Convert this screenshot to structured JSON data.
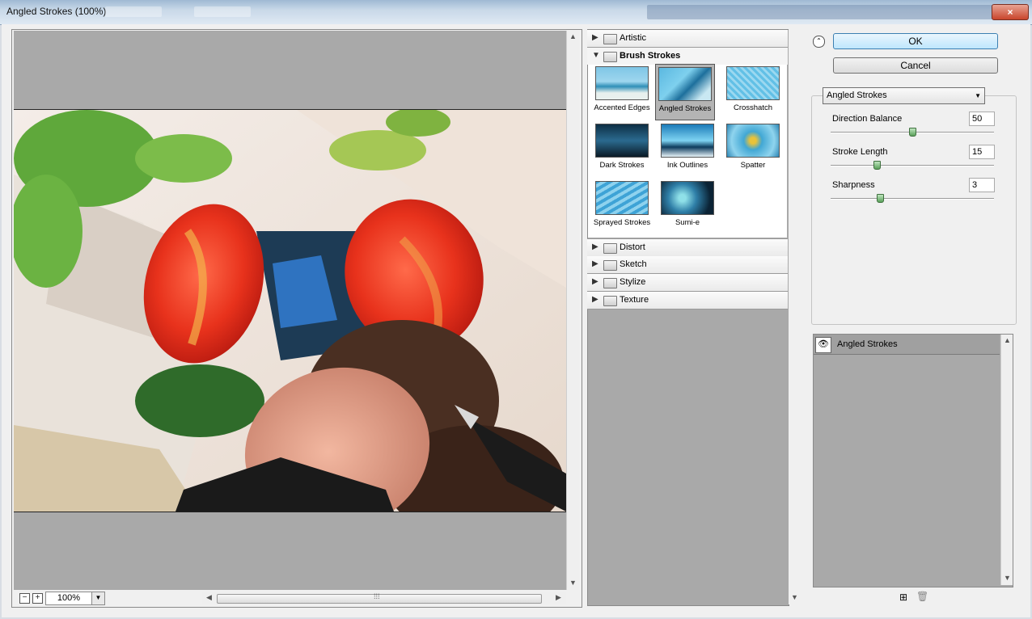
{
  "window": {
    "title": "Angled Strokes (100%)",
    "close_glyph": "×"
  },
  "preview": {
    "zoom": "100%",
    "zoom_out_glyph": "−",
    "zoom_in_glyph": "+",
    "hscroll_grip": "⁞⁞⁞"
  },
  "gallery": {
    "categories": [
      {
        "label": "Artistic",
        "expanded": false
      },
      {
        "label": "Brush Strokes",
        "expanded": true
      },
      {
        "label": "Distort",
        "expanded": false
      },
      {
        "label": "Sketch",
        "expanded": false
      },
      {
        "label": "Stylize",
        "expanded": false
      },
      {
        "label": "Texture",
        "expanded": false
      }
    ],
    "thumbnails": [
      {
        "label": "Accented Edges",
        "selected": false
      },
      {
        "label": "Angled Strokes",
        "selected": true
      },
      {
        "label": "Crosshatch",
        "selected": false
      },
      {
        "label": "Dark Strokes",
        "selected": false
      },
      {
        "label": "Ink Outlines",
        "selected": false
      },
      {
        "label": "Spatter",
        "selected": false
      },
      {
        "label": "Sprayed Strokes",
        "selected": false
      },
      {
        "label": "Sumi-e",
        "selected": false
      }
    ]
  },
  "actions": {
    "ok_label": "OK",
    "cancel_label": "Cancel"
  },
  "settings": {
    "filter_name": "Angled Strokes",
    "params": [
      {
        "label": "Direction Balance",
        "value": "50",
        "level": 0.5
      },
      {
        "label": "Stroke Length",
        "value": "15",
        "level": 0.28
      },
      {
        "label": "Sharpness",
        "value": "3",
        "level": 0.3
      }
    ]
  },
  "layers": {
    "items": [
      {
        "label": "Angled Strokes",
        "visible": true
      }
    ],
    "new_layer_glyph": "⊞",
    "delete_glyph": "🗑"
  },
  "colors": {
    "accent_ok": "#bee6fd",
    "selected_thumb": "#b4b4b4",
    "panel_gray": "#a9a9a9"
  }
}
